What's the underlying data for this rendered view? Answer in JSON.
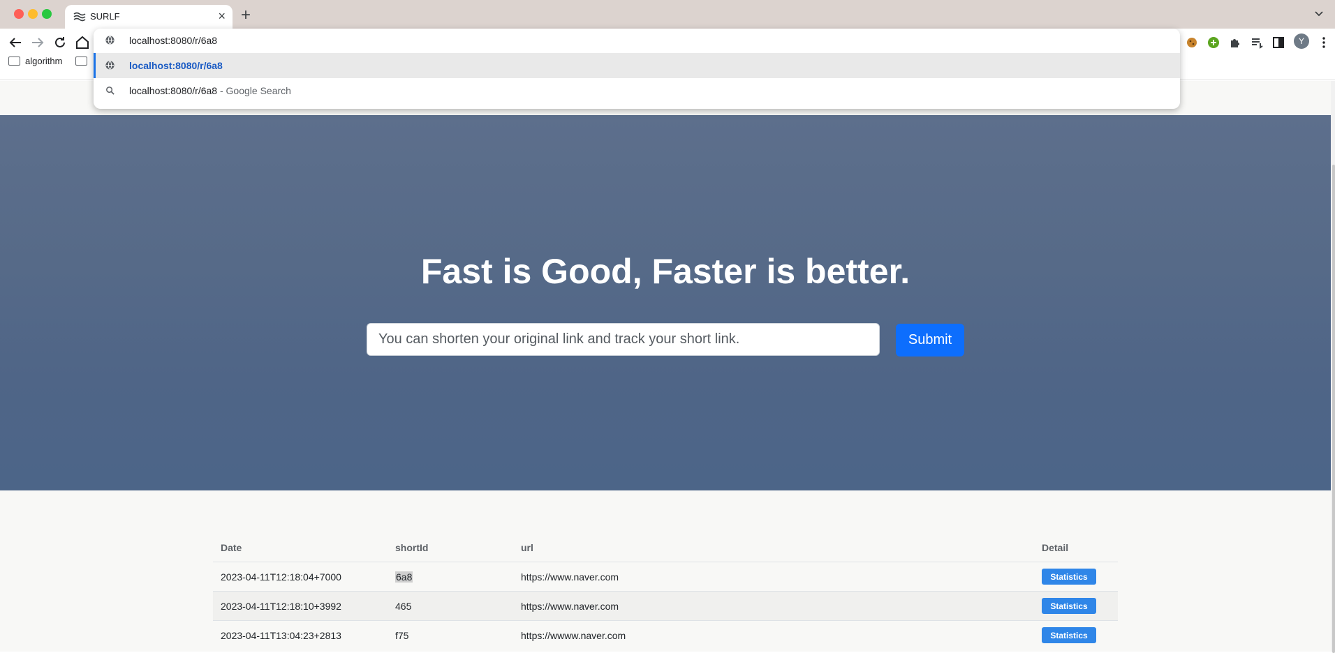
{
  "browser": {
    "tab": {
      "title": "SURLF"
    },
    "address_value": "localhost:8080/r/6a8",
    "suggestions": [
      {
        "text": "localhost:8080/r/6a8",
        "suffix": ""
      },
      {
        "text": "localhost:8080/r/6a8",
        "suffix": " - Google Search"
      }
    ],
    "bookmarks": [
      {
        "label": "algorithm"
      }
    ],
    "profile_initial": "Y"
  },
  "hero": {
    "title": "Fast is Good, Faster is better.",
    "input_placeholder": "You can shorten your original link and track your short link.",
    "submit_label": "Submit"
  },
  "table": {
    "headers": {
      "date": "Date",
      "shortid": "shortId",
      "url": "url",
      "detail": "Detail"
    },
    "rows": [
      {
        "date": "2023-04-11T12:18:04+7000",
        "shortid": "6a8",
        "url": "https://www.naver.com",
        "detail": "Statistics"
      },
      {
        "date": "2023-04-11T12:18:10+3992",
        "shortid": "465",
        "url": "https://www.naver.com",
        "detail": "Statistics"
      },
      {
        "date": "2023-04-11T13:04:23+2813",
        "shortid": "f75",
        "url": "https://wwww.naver.com",
        "detail": "Statistics"
      }
    ]
  },
  "colors": {
    "accent": "#0d6efd",
    "statistics_button": "#2f86e8",
    "hero_bg": "#566a88"
  }
}
